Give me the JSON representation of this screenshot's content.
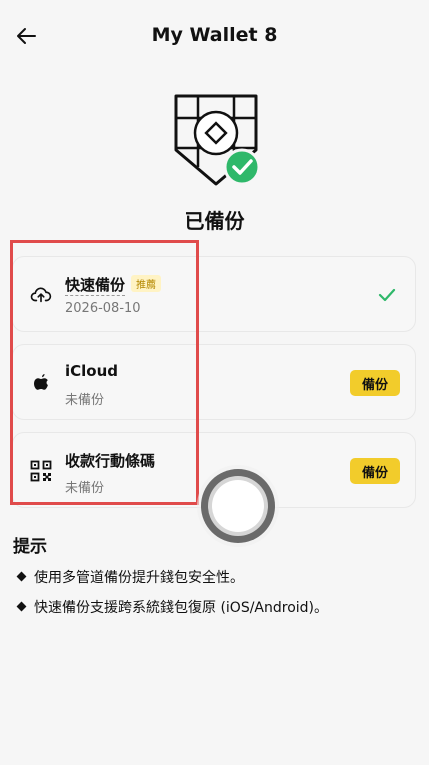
{
  "header": {
    "title": "My Wallet 8"
  },
  "status": {
    "label": "已備份"
  },
  "options": [
    {
      "name": "快速備份",
      "tag": "推薦",
      "sub": "2026-08-10"
    },
    {
      "name": "iCloud",
      "sub": "未備份",
      "action": "備份"
    },
    {
      "name": "收款行動條碼",
      "sub": "未備份",
      "action": "備份"
    }
  ],
  "tips": {
    "title": "提示",
    "items": [
      "使用多管道備份提升錢包安全性。",
      "快速備份支援跨系統錢包復原 (iOS/Android)。"
    ]
  },
  "colors": {
    "accent": "#f2cc2b",
    "success": "#2fb86a",
    "highlight": "#e04b4b"
  },
  "icons": [
    "back-arrow-icon",
    "shield-check-icon",
    "cloud-upload-icon",
    "apple-icon",
    "qr-code-icon",
    "checkmark-icon"
  ]
}
